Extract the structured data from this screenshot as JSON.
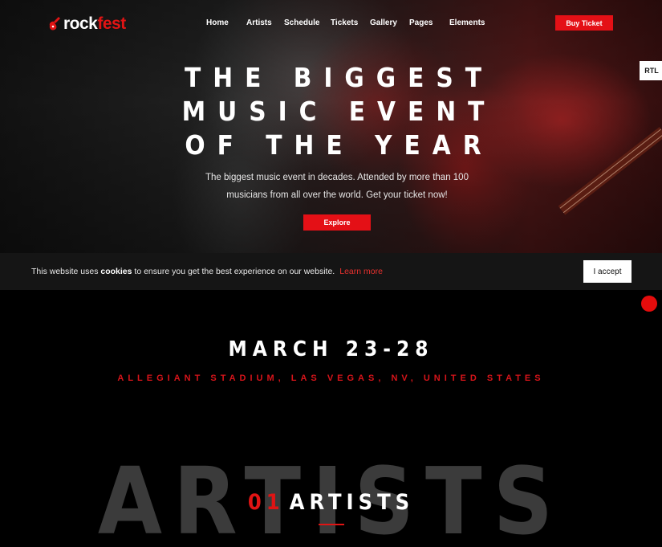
{
  "nav": {
    "logo_part1": "rock",
    "logo_part2": "fest",
    "items": [
      "Home",
      "Artists",
      "Schedule",
      "Tickets",
      "Gallery",
      "Pages",
      "Elements"
    ],
    "buy_ticket": "Buy Ticket"
  },
  "rtl": "RTL",
  "hero": {
    "title_lines": [
      "THE BIGGEST",
      "MUSIC EVENT",
      "OF THE YEAR"
    ],
    "subtitle_line1": "The biggest music event in decades. Attended by more than 100",
    "subtitle_line2": "musicians from all over the world. Get your ticket now!",
    "explore": "Explore"
  },
  "cookie": {
    "text_before": "This website uses ",
    "text_bold": "cookies",
    "text_after": " to ensure you get the best experience on our website.",
    "learn_more": "Learn more",
    "accept": "I accept"
  },
  "event": {
    "date": "MARCH 23-28",
    "venue": "ALLEGIANT STADIUM, LAS VEGAS, NV, UNITED STATES"
  },
  "artists": {
    "bg_text": "ARTISTS",
    "number": "01",
    "title": "ARTISTS"
  },
  "colors": {
    "accent": "#e41016",
    "cookie_bg": "#151515",
    "page_bg": "#000000"
  },
  "icons": {
    "logo": "guitar-icon"
  }
}
